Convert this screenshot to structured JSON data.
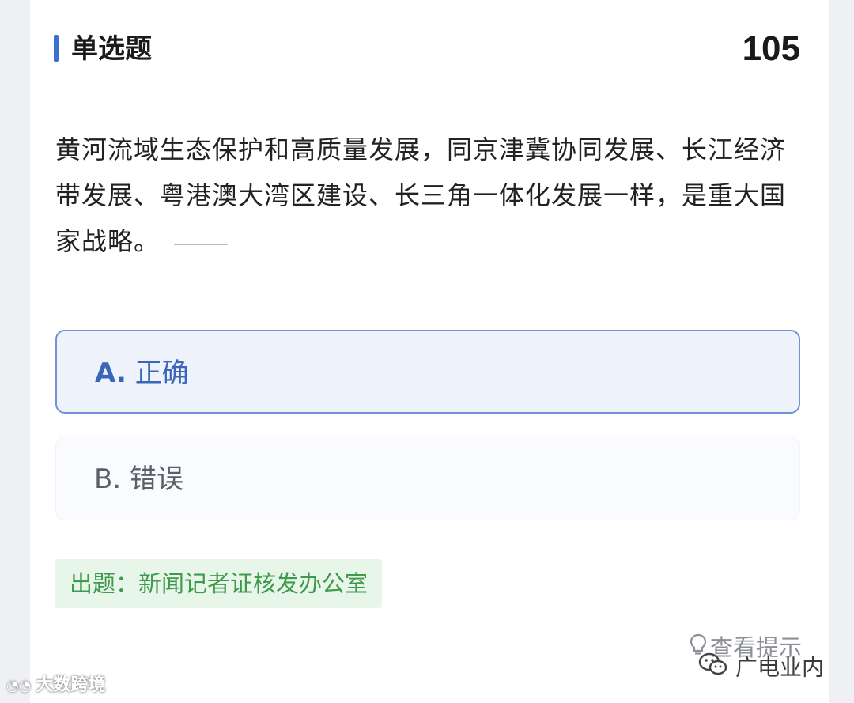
{
  "header": {
    "question_type": "单选题",
    "question_number": "105"
  },
  "question": {
    "text": "黄河流域生态保护和高质量发展，同京津冀协同发展、长江经济带发展、粤港澳大湾区建设、长三角一体化发展一样，是重大国家战略。"
  },
  "options": [
    {
      "letter": "A.",
      "text": "正确",
      "selected": true
    },
    {
      "letter": "B.",
      "text": "错误",
      "selected": false
    }
  ],
  "source": {
    "text": "出题：新闻记者证核发办公室"
  },
  "hint": {
    "label": "查看提示",
    "icon": "lightbulb-icon"
  },
  "watermarks": {
    "left": "大数跨境",
    "right": "广电业内"
  },
  "colors": {
    "accent": "#3b6fd0",
    "selected_bg": "#eef2fb",
    "selected_border": "#6f93d6",
    "source_bg": "#e8f6ea",
    "source_text": "#3e9a4c"
  }
}
